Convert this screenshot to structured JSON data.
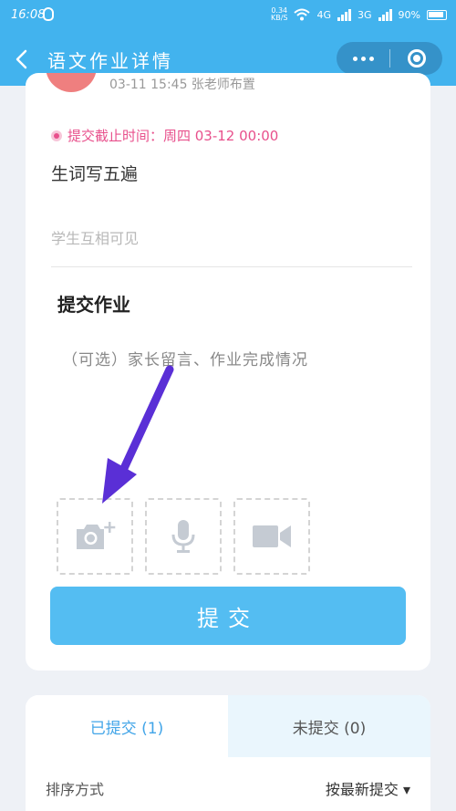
{
  "status": {
    "time": "16:08",
    "net_speed_top": "0.34",
    "net_speed_unit": "KB/S",
    "net1": "4G",
    "net2": "3G",
    "battery": "90%"
  },
  "nav": {
    "title": "语文作业详情"
  },
  "homework": {
    "assigned": "03-11 15:45 张老师布置",
    "deadline": "提交截止时间：周四 03-12 00:00",
    "task": "生词写五遍",
    "visibility": "学生互相可见"
  },
  "submit": {
    "title": "提交作业",
    "note_placeholder": "（可选）家长留言、作业完成情况",
    "button": "提交"
  },
  "tabs": {
    "submitted": "已提交 (1)",
    "unsubmitted": "未提交 (0)"
  },
  "sort": {
    "label": "排序方式",
    "value": "按最新提交 ▾"
  },
  "colors": {
    "primary": "#42b3ee",
    "button": "#54bdf2",
    "deadline": "#e8508c",
    "annotation_arrow": "#5a2fd6"
  }
}
